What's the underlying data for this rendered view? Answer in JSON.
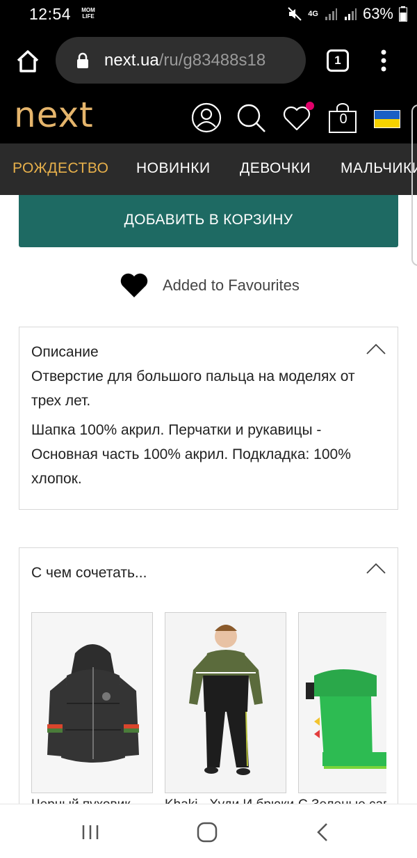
{
  "status_bar": {
    "time": "12:54",
    "badge": "MOM LIFE",
    "network": "4G",
    "battery": "63%"
  },
  "browser": {
    "url_host": "next.ua",
    "url_path": "/ru/g83488s18",
    "tab_count": "1"
  },
  "header": {
    "logo": "next",
    "bag_count": "0",
    "brand_color": "#e5b56c",
    "wishlist_dot_color": "#e2006a"
  },
  "nav": {
    "items": [
      {
        "label": "РОЖДЕСТВО",
        "active": true
      },
      {
        "label": "НОВИНКИ",
        "active": false
      },
      {
        "label": "ДЕВОЧКИ",
        "active": false
      },
      {
        "label": "МАЛЬЧИКИ",
        "active": false
      }
    ],
    "active_color": "#e7b04b"
  },
  "actions": {
    "add_to_cart": "ДОБАВИТЬ В КОРЗИНУ",
    "add_to_cart_color": "#1e6a63",
    "favourites": "Added to Favourites"
  },
  "description": {
    "title": "Описание",
    "paragraph1": "Отверстие для большого пальца на моделях от трех лет.",
    "paragraph2": "Шапка 100% акрил. Перчатки и рукавицы - Основная часть 100% акрил. Подкладка: 100% хлопок."
  },
  "pair_with": {
    "title": "С чем сочетать...",
    "products": [
      {
        "name": "Черный пуховик",
        "image": "jacket-image"
      },
      {
        "name": "Khaki - Худи И брюки",
        "image": "tracksuit-image"
      },
      {
        "name": "С Зеленые сапоги",
        "image": "boots-image"
      }
    ]
  }
}
